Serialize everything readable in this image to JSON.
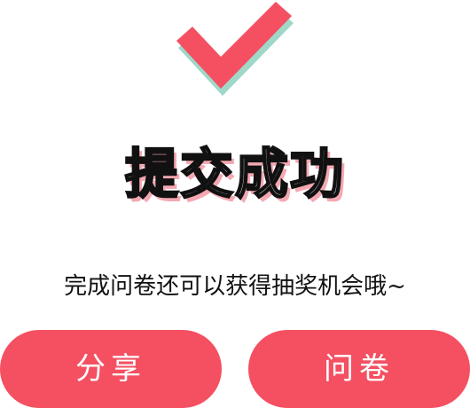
{
  "page": {
    "title": "提交成功",
    "subtitle": "完成问卷还可以获得抽奖机会哦~"
  },
  "icons": {
    "success": "check-mark-icon"
  },
  "buttons": {
    "share_label": "分享",
    "survey_label": "问卷"
  },
  "colors": {
    "accent": "#f45062",
    "check_shadow": "#9fd8c9",
    "title_shadow": "#f4a8b2"
  }
}
